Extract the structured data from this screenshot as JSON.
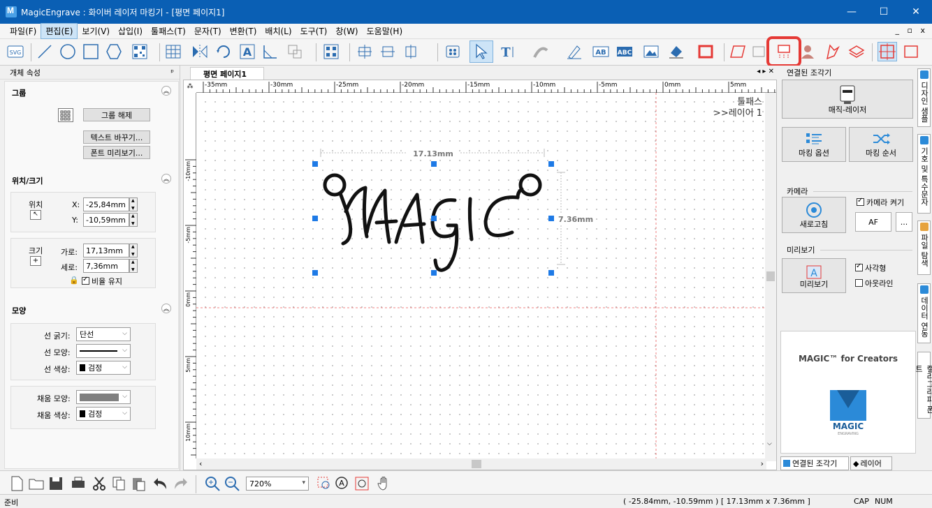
{
  "window": {
    "title": "MagicEngrave : 화이버 레이저 마킹기 - [평면  페이지1]",
    "controls": [
      "—",
      "☐",
      "✕"
    ]
  },
  "menu": {
    "items": [
      "파일(F)",
      "편집(E)",
      "보기(V)",
      "삽입(I)",
      "툴패스(T)",
      "문자(T)",
      "변환(T)",
      "배치(L)",
      "도구(T)",
      "창(W)",
      "도움말(H)"
    ],
    "active": "편집(E)",
    "mdi_controls": "_ ▫ x"
  },
  "toolbar": {
    "svg_label": "SVG",
    "highlighted_tool": "marking-laser-tool-icon"
  },
  "left_panel": {
    "title": "개체 속성",
    "pin": "ᵖ",
    "group": {
      "title": "그룹",
      "ungroup_button": "그룹 해제",
      "replace_text_button": "텍스트 바꾸기...",
      "font_preview_button": "폰트 미리보기..."
    },
    "position_size": {
      "title": "위치/크기",
      "position_label": "위치",
      "x_label": "X:",
      "x_value": "-25,84mm",
      "y_label": "Y:",
      "y_value": "-10,59mm",
      "size_label": "크기",
      "width_label": "가로:",
      "width_value": "17,13mm",
      "height_label": "세로:",
      "height_value": "7,36mm",
      "keep_ratio_label": "비율 유지",
      "keep_ratio_checked": true
    },
    "shape": {
      "title": "모양",
      "line_width_label": "선 굵기:",
      "line_width_value": "단선",
      "line_style_label": "선 모양:",
      "line_color_label": "선 색상:",
      "line_color_value": "검정",
      "fill_style_label": "채움 모양:",
      "fill_color_label": "채움 색상:",
      "fill_color_value": "검정"
    }
  },
  "document": {
    "tab_label": "평면  페이지1",
    "ruler_top_labels": [
      "-35mm",
      "-30mm",
      "-25mm",
      "-20mm",
      "-15mm",
      "-10mm",
      "-5mm",
      "0mm",
      "5mm"
    ],
    "ruler_left_labels": [
      "-10mm",
      "-5mm",
      "0mm",
      "5mm",
      "10mm"
    ],
    "overlay_line1": "툴패스",
    "overlay_line2": ">>레이어 1",
    "object_text": "MAGIC",
    "dim_width": "17.13mm",
    "dim_height": "7.36mm"
  },
  "right_panel": {
    "title": "연결된 조각기",
    "device_button": "매직-레이저",
    "marking_options_button": "마킹 옵션",
    "marking_order_button": "마킹 순서",
    "camera_group": "카메라",
    "refresh_button": "새로고침",
    "camera_on_label": "카메라 켜기",
    "camera_on_checked": true,
    "af_button": "AF",
    "more_button": "...",
    "preview_group": "미리보기",
    "preview_button": "미리보기",
    "rect_label": "사각형",
    "rect_checked": true,
    "outline_label": "아웃라인",
    "outline_checked": false,
    "logo_caption": "MAGIC™ for Creators",
    "logo_text": "MAGIC",
    "logo_subtext": "ENGRAVING",
    "bottom_tabs": [
      "연결된 조각기",
      "레이어"
    ]
  },
  "vertical_tabs": [
    "디자인 샘플",
    "기호 및 특수문자",
    "파일 탐색",
    "데이터 연동",
    "캘리그라피 폰트"
  ],
  "bottom_toolbar": {
    "zoom_value": "720%"
  },
  "status": {
    "left": "준비",
    "coords": "( -25.84mm, -10.59mm )  [ 17.13mm x 7.36mm ]",
    "cap": "CAP",
    "num": "NUM"
  },
  "colors": {
    "titlebar": "#0a5fb4",
    "highlight": "#e53935",
    "handle": "#1e7ae6",
    "accent_blue": "#2b8ad8"
  }
}
